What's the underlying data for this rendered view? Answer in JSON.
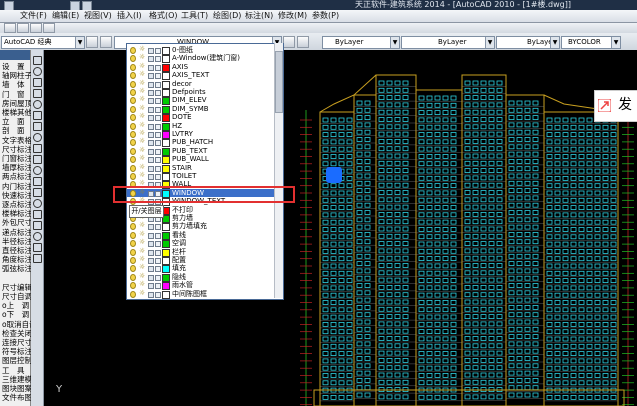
{
  "title_bar": {
    "title": "天正软件-建筑系统 2014 - [AutoCAD 2010 - [1#楼.dwg]]"
  },
  "menu": [
    "文件(F)",
    "编辑(E)",
    "视图(V)",
    "插入(I)",
    "格式(O)",
    "工具(T)",
    "绘图(D)",
    "标注(N)",
    "修改(M)",
    "参数(P)"
  ],
  "workspace": {
    "value": "AutoCAD 经典"
  },
  "layer_combo": {
    "value": "WINDOW"
  },
  "props": {
    "color": "ByLayer",
    "linetype": "ByLayer",
    "lineweight": "ByLayer",
    "plotstyle": "BYCOLOR"
  },
  "left_panel": {
    "items": [
      "设　置",
      "轴网柱子",
      "墙　体",
      "门　窗",
      "房间屋顶",
      "楼梯其他",
      "立　面",
      "剖　面",
      "文字表格",
      "尺寸标注",
      "门窗标注",
      "墙厚标注",
      "两点标注",
      "内门标注",
      "快速标注",
      "逐点标注",
      "楼梯标注",
      "外包尺寸",
      "递点标注",
      "半径标注",
      "直径标注",
      "角度标注",
      "弧弦标注",
      "",
      "尺寸编辑",
      "尺寸自调",
      "o上　调",
      "o下　调",
      "o取消自调",
      "检查关闭",
      "连接尺寸",
      "符号标注",
      "图层控制",
      "工　具",
      "三维建模",
      "图块图案",
      "文件布图"
    ]
  },
  "layers": [
    {
      "name": "0-图纸",
      "color": "#ffffff"
    },
    {
      "name": "A-Window(建筑门窗)",
      "color": "#ffffff"
    },
    {
      "name": "AXIS",
      "color": "#ff0000"
    },
    {
      "name": "AXIS_TEXT",
      "color": "#ffffff"
    },
    {
      "name": "decor",
      "color": "#ffffff"
    },
    {
      "name": "Defpoints",
      "color": "#ffffff"
    },
    {
      "name": "DIM_ELEV",
      "color": "#00cc00"
    },
    {
      "name": "DIM_SYMB",
      "color": "#00cc00"
    },
    {
      "name": "DOTE",
      "color": "#ff0000"
    },
    {
      "name": "HZ",
      "color": "#00cc00"
    },
    {
      "name": "LVTRY",
      "color": "#ff00ff"
    },
    {
      "name": "PUB_HATCH",
      "color": "#ffffff"
    },
    {
      "name": "PUB_TEXT",
      "color": "#00cc00"
    },
    {
      "name": "PUB_WALL",
      "color": "#ffff00"
    },
    {
      "name": "STAIR",
      "color": "#ffff00"
    },
    {
      "name": "TOILET",
      "color": "#ffffff"
    },
    {
      "name": "WALL",
      "color": "#ffff00"
    },
    {
      "name": "WINDOW",
      "color": "#00ffff"
    },
    {
      "name": "WINDOW_TEXT",
      "color": "#ffffff"
    },
    {
      "name": "不打印",
      "color": "#ff0000"
    },
    {
      "name": "剪力墙",
      "color": "#00cc00"
    },
    {
      "name": "剪力墙填充",
      "color": "#ffffff"
    },
    {
      "name": "看线",
      "color": "#00cc00"
    },
    {
      "name": "空调",
      "color": "#00cc00"
    },
    {
      "name": "栏杆",
      "color": "#ffff00"
    },
    {
      "name": "配置",
      "color": "#ffffff"
    },
    {
      "name": "填充",
      "color": "#00ffff"
    },
    {
      "name": "隐线",
      "color": "#00cc00"
    },
    {
      "name": "雨水管",
      "color": "#ff00ff"
    },
    {
      "name": "中间陈图框",
      "color": "#ffffff"
    }
  ],
  "selected_layer_index": 17,
  "tooltip": {
    "text": "开/关图层"
  },
  "popup": {
    "text": "发"
  },
  "ucs": {
    "label": "Y"
  }
}
